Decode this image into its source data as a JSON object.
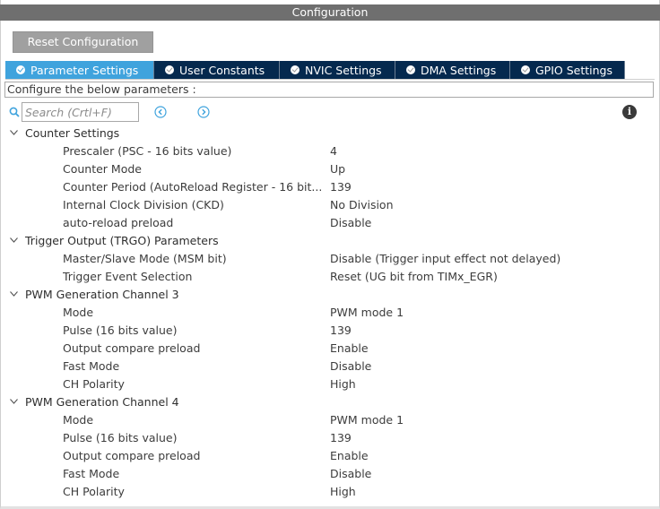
{
  "window": {
    "title": "Configuration"
  },
  "toolbar": {
    "reset_label": "Reset Configuration"
  },
  "tabs": [
    {
      "label": "Parameter Settings",
      "active": true
    },
    {
      "label": "User Constants",
      "active": false
    },
    {
      "label": "NVIC Settings",
      "active": false
    },
    {
      "label": "DMA Settings",
      "active": false
    },
    {
      "label": "GPIO Settings",
      "active": false
    }
  ],
  "description": "Configure the below parameters :",
  "search": {
    "placeholder": "Search (Crtl+F)"
  },
  "icons": {
    "search": "search-icon",
    "prev": "circle-chevron-left-icon",
    "next": "circle-chevron-right-icon",
    "info": "info-icon",
    "expand": "chevron-down-icon"
  },
  "colors": {
    "tab_active": "#3fa3dd",
    "tab_inactive": "#05294e",
    "titlebar": "#6f6f6f",
    "button": "#a0a0a0",
    "nav_icon": "#3fa3dd"
  },
  "groups": [
    {
      "name": "Counter Settings",
      "params": [
        {
          "name": "Prescaler (PSC - 16 bits value)",
          "value": "4"
        },
        {
          "name": "Counter Mode",
          "value": "Up"
        },
        {
          "name": "Counter Period (AutoReload Register - 16 bit...",
          "value": "139"
        },
        {
          "name": "Internal Clock Division (CKD)",
          "value": "No Division"
        },
        {
          "name": "auto-reload preload",
          "value": "Disable"
        }
      ]
    },
    {
      "name": "Trigger Output (TRGO) Parameters",
      "params": [
        {
          "name": "Master/Slave Mode (MSM bit)",
          "value": "Disable (Trigger input effect not delayed)"
        },
        {
          "name": "Trigger Event Selection",
          "value": "Reset (UG bit from TIMx_EGR)"
        }
      ]
    },
    {
      "name": "PWM Generation Channel 3",
      "params": [
        {
          "name": "Mode",
          "value": "PWM mode 1"
        },
        {
          "name": "Pulse (16 bits value)",
          "value": "139"
        },
        {
          "name": "Output compare preload",
          "value": "Enable"
        },
        {
          "name": "Fast Mode",
          "value": "Disable"
        },
        {
          "name": "CH Polarity",
          "value": "High"
        }
      ]
    },
    {
      "name": "PWM Generation Channel 4",
      "params": [
        {
          "name": "Mode",
          "value": "PWM mode 1"
        },
        {
          "name": "Pulse (16 bits value)",
          "value": "139"
        },
        {
          "name": "Output compare preload",
          "value": "Enable"
        },
        {
          "name": "Fast Mode",
          "value": "Disable"
        },
        {
          "name": "CH Polarity",
          "value": "High"
        }
      ]
    }
  ]
}
